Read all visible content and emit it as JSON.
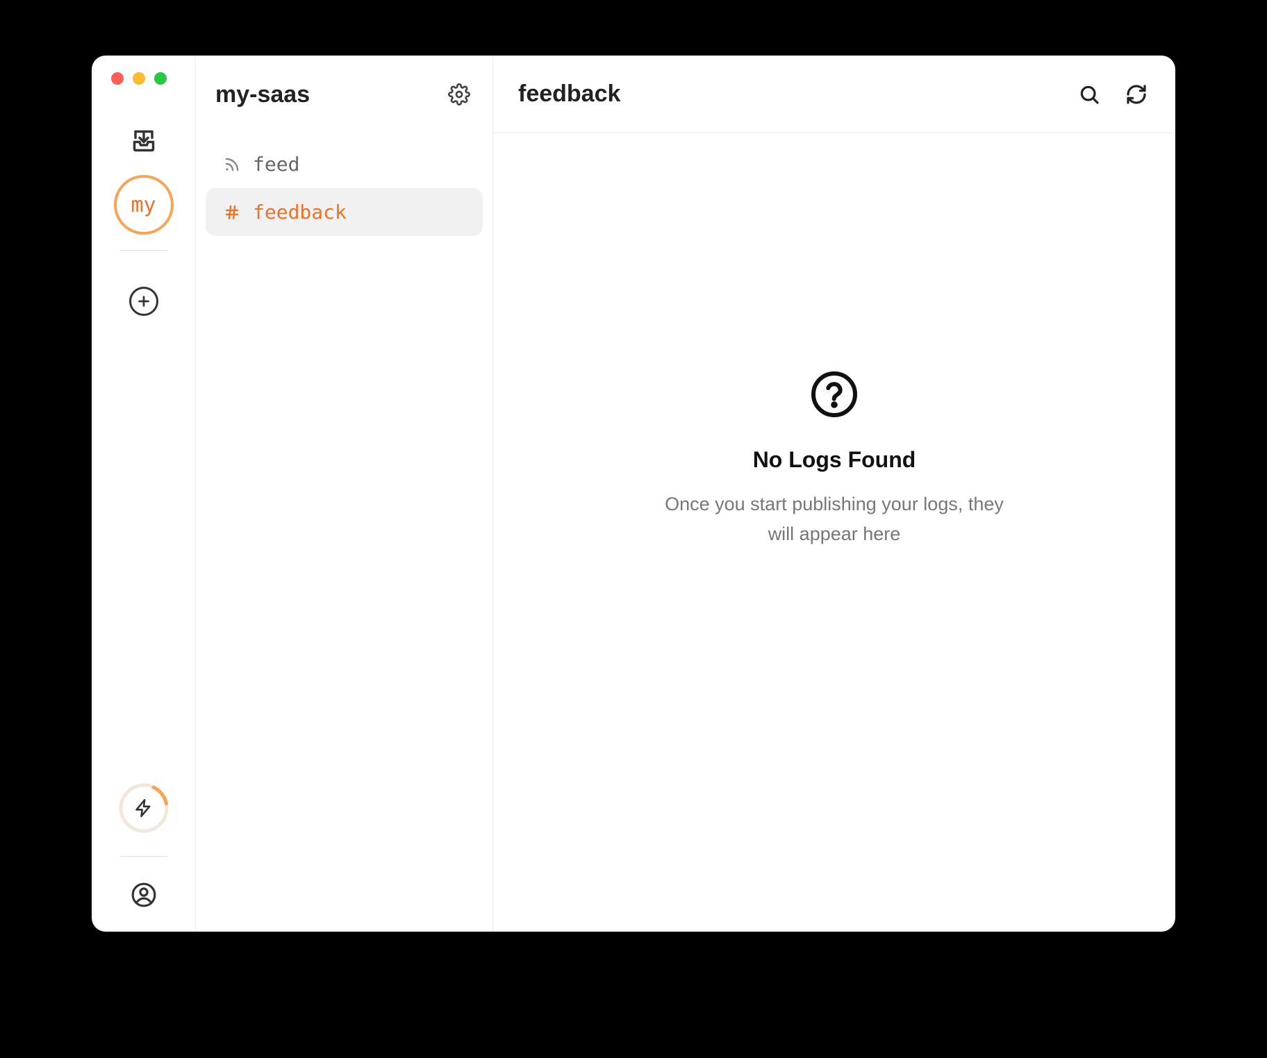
{
  "rail": {
    "project_avatar_text": "my"
  },
  "sidebar": {
    "title": "my-saas",
    "channels": [
      {
        "icon": "rss",
        "label": "feed",
        "active": false
      },
      {
        "icon": "hash",
        "label": "feedback",
        "active": true
      }
    ]
  },
  "main": {
    "title": "feedback",
    "empty": {
      "title": "No Logs Found",
      "subtitle": "Once you start publishing your logs, they will appear here"
    }
  },
  "colors": {
    "accent": "#E8742C",
    "accent_light": "#F7A554"
  }
}
